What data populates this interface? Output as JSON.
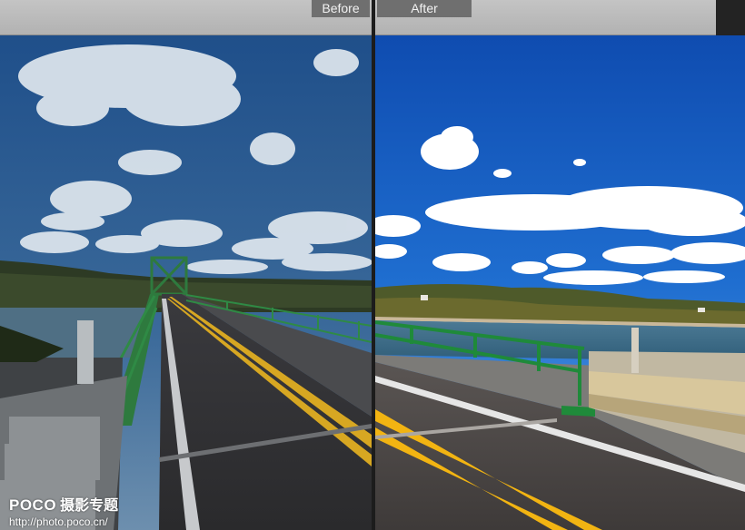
{
  "toolbar": {
    "before_label": "Before",
    "after_label": "After"
  },
  "watermark": {
    "brand": "POCO",
    "brand_sub": "摄影专题",
    "url": "http://photo.poco.cn/"
  }
}
